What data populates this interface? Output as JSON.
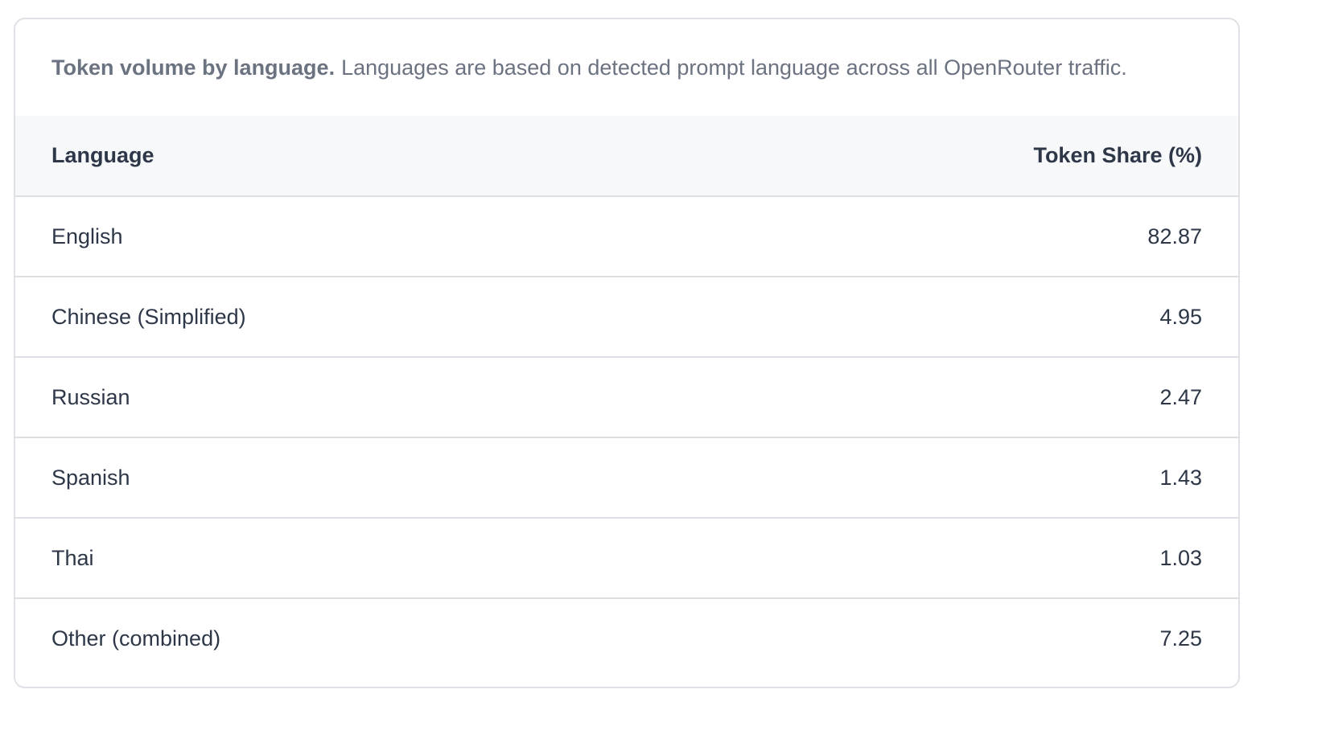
{
  "caption": {
    "bold": "Token volume by language.",
    "text": "Languages are based on detected prompt language across all OpenRouter traffic."
  },
  "table": {
    "headers": [
      "Language",
      "Token Share (%)"
    ],
    "rows": [
      {
        "language": "English",
        "share": "82.87"
      },
      {
        "language": "Chinese (Simplified)",
        "share": "4.95"
      },
      {
        "language": "Russian",
        "share": "2.47"
      },
      {
        "language": "Spanish",
        "share": "1.43"
      },
      {
        "language": "Thai",
        "share": "1.03"
      },
      {
        "language": "Other (combined)",
        "share": "7.25"
      }
    ]
  }
}
